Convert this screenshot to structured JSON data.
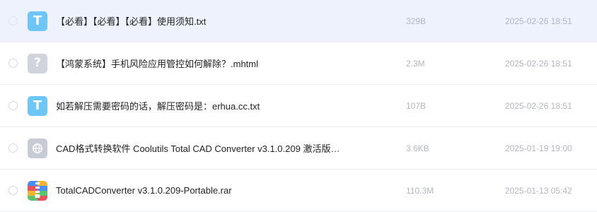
{
  "files": [
    {
      "name": "【必看】【必看】【必看】使用须知.txt",
      "size": "329B",
      "date": "2025‑02‑26 18:51",
      "icon_glyph": "T",
      "icon": "txt-file-icon",
      "selected": true
    },
    {
      "name": "【鸿蒙系统】手机风险应用管控如何解除？.mhtml",
      "size": "2.3M",
      "date": "2025‑02‑26 18:51",
      "icon_glyph": "?",
      "icon": "unknown-file-icon",
      "selected": false
    },
    {
      "name": "如若解压需要密码的话，解压密码是：erhua.cc.txt",
      "size": "107B",
      "date": "2025‑02‑26 18:51",
      "icon_glyph": "T",
      "icon": "txt-file-icon",
      "selected": false
    },
    {
      "name": "CAD格式转换软件 Coolutils Total CAD Converter v3.1.0.209 激活版…",
      "size": "3.6KB",
      "date": "2025‑01‑19 19:00",
      "icon": "link-file-icon",
      "selected": false
    },
    {
      "name": "TotalCADConverter v3.1.0.209-Portable.rar",
      "size": "110.3M",
      "date": "2025‑01‑13 05:42",
      "icon": "archive-file-icon",
      "selected": false
    }
  ],
  "colors": {
    "selected_row_bg": "#eef2fd",
    "txt_icon": "#6ec5f7",
    "unknown_icon": "#d0d4dc",
    "link_icon": "#c6cbd6",
    "meta_text": "#b2b6be"
  }
}
